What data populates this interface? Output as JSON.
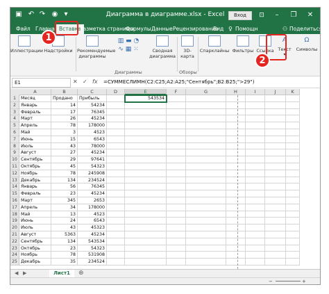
{
  "titlebar": {
    "title": "Диаграмма в диаграмме.xlsx  -  Excel",
    "login_label": "Вход",
    "minimize": "–",
    "restore": "❐",
    "close": "✕",
    "accent_color": "#217346"
  },
  "tabs": [
    {
      "label": "Файл",
      "key": "file"
    },
    {
      "label": "Главная",
      "key": "home"
    },
    {
      "label": "Вставка",
      "key": "insert",
      "active": true
    },
    {
      "label": "Разметка страницы",
      "key": "layout"
    },
    {
      "label": "Формулы",
      "key": "formulas"
    },
    {
      "label": "Данные",
      "key": "data"
    },
    {
      "label": "Рецензирование",
      "key": "review"
    },
    {
      "label": "Вид",
      "key": "view"
    },
    {
      "label": "Помощн",
      "key": "help"
    },
    {
      "label": "Поделиться",
      "key": "share"
    }
  ],
  "ribbon": {
    "illustrations": "Иллюстрации",
    "addins": "Надстройки",
    "recommended_charts": "Рекомендуемые диаграммы",
    "pivot_chart": "Сводная диаграмма",
    "map_3d": "3D-карта",
    "sparklines": "Спарклайны",
    "filters": "Фильтры",
    "link": "Ссылка",
    "text": "Текст",
    "symbols": "Символы",
    "group_charts": "Диаграммы",
    "group_tours": "Обзоры"
  },
  "formula_bar": {
    "name_box": "E1",
    "fx": "fx",
    "formula": "=СУММЕСЛИМН(C2:C25;A2:A25;\"Сентябрь\";B2:B25;\">29\")"
  },
  "columns": [
    "A",
    "B",
    "C",
    "D",
    "E",
    "F",
    "G",
    "H",
    "I",
    "J",
    "K"
  ],
  "header_row": [
    "Месяц",
    "Продано",
    "Прибыль"
  ],
  "rows": [
    {
      "month": "Январь",
      "sold": "14",
      "profit": "54234"
    },
    {
      "month": "Февраль",
      "sold": "17",
      "profit": "76345"
    },
    {
      "month": "Март",
      "sold": "26",
      "profit": "45234"
    },
    {
      "month": "Апрель",
      "sold": "78",
      "profit": "178000"
    },
    {
      "month": "Май",
      "sold": "3",
      "profit": "4523"
    },
    {
      "month": "Июнь",
      "sold": "15",
      "profit": "6543"
    },
    {
      "month": "Июль",
      "sold": "43",
      "profit": "78000"
    },
    {
      "month": "Август",
      "sold": "27",
      "profit": "45234"
    },
    {
      "month": "Сентябрь",
      "sold": "29",
      "profit": "97641"
    },
    {
      "month": "Октябрь",
      "sold": "45",
      "profit": "54323"
    },
    {
      "month": "Ноябрь",
      "sold": "78",
      "profit": "245908"
    },
    {
      "month": "Декабрь",
      "sold": "134",
      "profit": "234524"
    },
    {
      "month": "Январь",
      "sold": "56",
      "profit": "76345"
    },
    {
      "month": "Февраль",
      "sold": "23",
      "profit": "45234"
    },
    {
      "month": "Март",
      "sold": "345",
      "profit": "2653"
    },
    {
      "month": "Апрель",
      "sold": "34",
      "profit": "178000"
    },
    {
      "month": "Май",
      "sold": "13",
      "profit": "4523"
    },
    {
      "month": "Июнь",
      "sold": "24",
      "profit": "6543"
    },
    {
      "month": "Июль",
      "sold": "43",
      "profit": "45323"
    },
    {
      "month": "Август",
      "sold": "5363",
      "profit": "45234"
    },
    {
      "month": "Сентябрь",
      "sold": "134",
      "profit": "543534"
    },
    {
      "month": "Октябрь",
      "sold": "23",
      "profit": "54323"
    },
    {
      "month": "Ноябрь",
      "sold": "78",
      "profit": "531908"
    },
    {
      "month": "Декабрь",
      "sold": "35",
      "profit": "234524"
    }
  ],
  "result_cell": {
    "ref": "E1",
    "value": "543534"
  },
  "sheet_tab": "Лист1",
  "callouts": [
    "1",
    "2"
  ],
  "callout_color": "#e52620"
}
